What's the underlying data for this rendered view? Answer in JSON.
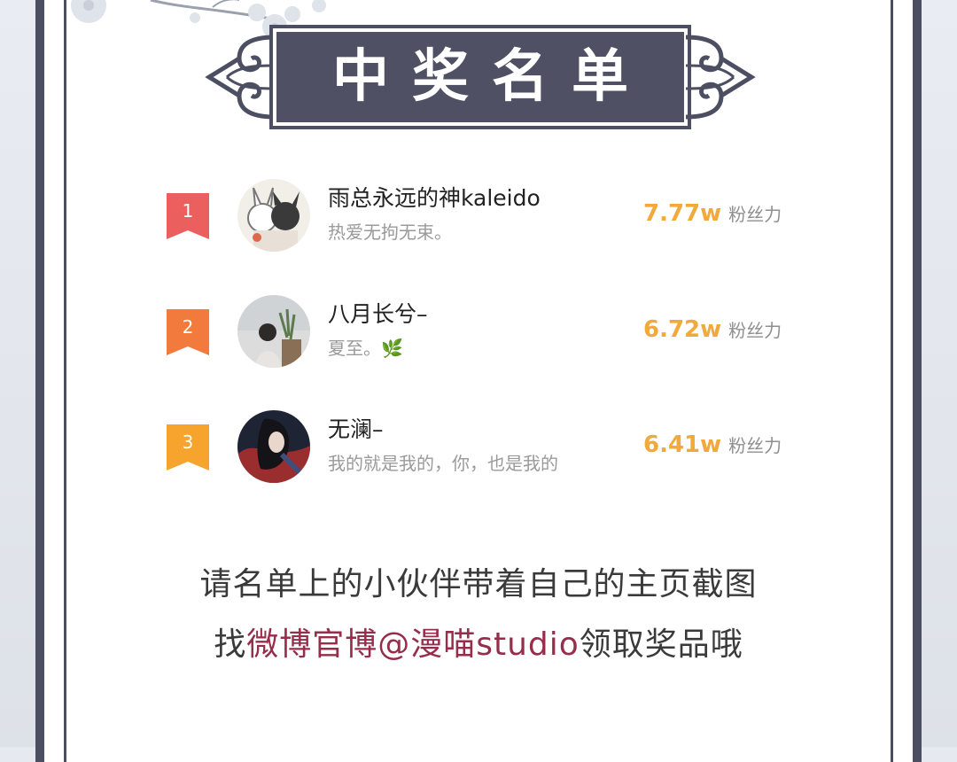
{
  "title": "中奖名单",
  "winners": [
    {
      "rank": "1",
      "name": "雨总永远的神kaleido",
      "bio": "热爱无拘无束。",
      "value": "7.77w",
      "unit": "粉丝力",
      "badge_color": "#ec5f5f"
    },
    {
      "rank": "2",
      "name": "八月长兮–",
      "bio": "夏至。🌿",
      "value": "6.72w",
      "unit": "粉丝力",
      "badge_color": "#f27a3c"
    },
    {
      "rank": "3",
      "name": "无澜–",
      "bio": "我的就是我的，你，也是我的",
      "value": "6.41w",
      "unit": "粉丝力",
      "badge_color": "#f7a42e"
    }
  ],
  "note": {
    "line1": "请名单上的小伙伴带着自己的主页截图",
    "line2_prefix": "找",
    "line2_highlight": "微博官博@漫喵studio",
    "line2_suffix": "领取奖品哦"
  },
  "colors": {
    "frame": "#4c4f61",
    "accent": "#962e4b",
    "value": "#f2a93b"
  }
}
